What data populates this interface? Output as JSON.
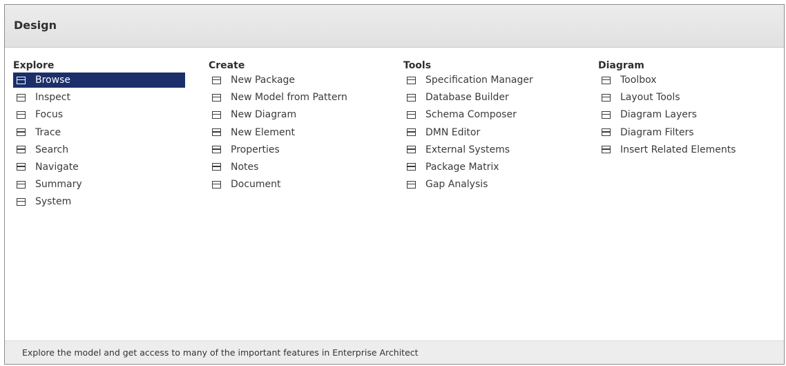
{
  "header": {
    "title": "Design"
  },
  "columns": [
    {
      "heading": "Explore",
      "items": [
        "Browse",
        "Inspect",
        "Focus",
        "Trace",
        "Search",
        "Navigate",
        "Summary",
        "System"
      ]
    },
    {
      "heading": "Create",
      "items": [
        "New Package",
        "New Model from Pattern",
        "New Diagram",
        "New Element",
        "Properties",
        "Notes",
        "Document"
      ]
    },
    {
      "heading": "Tools",
      "items": [
        "Specification Manager",
        "Database Builder",
        "Schema Composer",
        "DMN Editor",
        "External Systems",
        "Package Matrix",
        "Gap Analysis"
      ]
    },
    {
      "heading": "Diagram",
      "items": [
        "Toolbox",
        "Layout Tools",
        "Diagram Layers",
        "Diagram Filters",
        "Insert Related Elements"
      ]
    }
  ],
  "selected_item": "Browse",
  "footer": {
    "text": "Explore the model and get access to many of the important features in Enterprise Architect"
  },
  "colors": {
    "selection_background": "#1c2f6b",
    "header_background": "#e6e6e6",
    "footer_background": "#ededed"
  }
}
